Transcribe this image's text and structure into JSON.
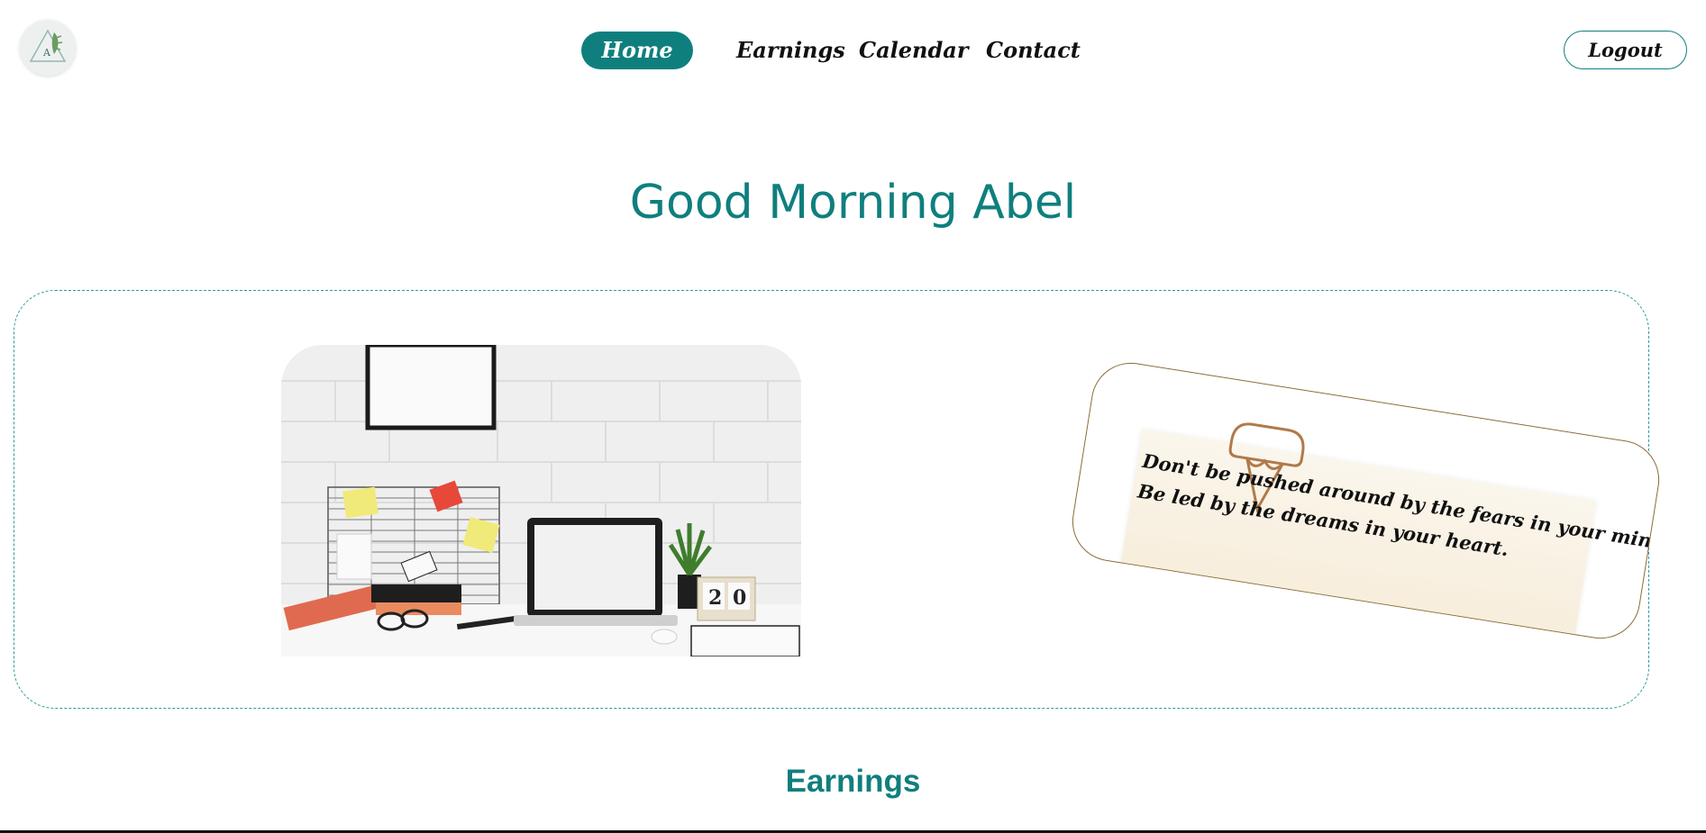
{
  "nav": {
    "logo_letter": "A",
    "links": [
      "Home",
      "Earnings",
      "Calendar",
      "Contact"
    ],
    "active": "Home",
    "logout_label": "Logout"
  },
  "greeting": "Good Morning Abel",
  "hero": {
    "desk_photo_calendar": [
      "2",
      "0"
    ],
    "quote_lines": [
      "Don't be pushed around by the fears in your mind.",
      "Be led by the dreams in your heart."
    ]
  },
  "section_title": "Earnings",
  "colors": {
    "accent": "#0f7f7e",
    "quote_border": "#8a6d3b"
  }
}
